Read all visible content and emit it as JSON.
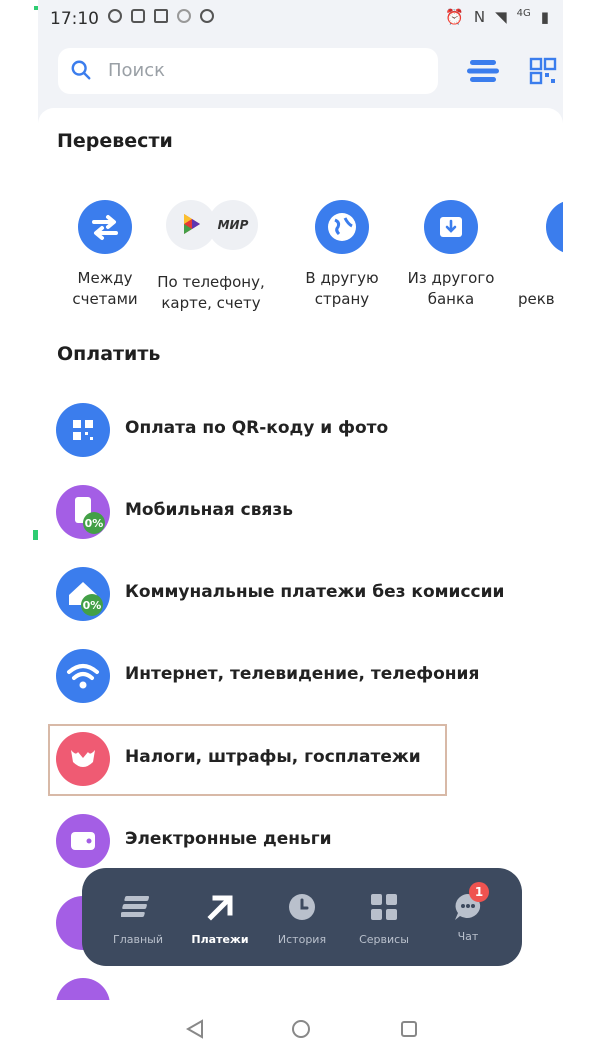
{
  "status_bar": {
    "time": "17:10",
    "network": "4G"
  },
  "search": {
    "placeholder": "Поиск"
  },
  "transfer": {
    "title": "Перевести",
    "items": [
      {
        "label_line1": "Между",
        "label_line2": "счетами",
        "icon": "arrows-exchange-icon"
      },
      {
        "label_line1": "По телефону,",
        "label_line2": "карте, счету",
        "icon": "sbp-mir-icon",
        "mir_text": "МИР"
      },
      {
        "label_line1": "В другую",
        "label_line2": "страну",
        "icon": "globe-icon"
      },
      {
        "label_line1": "Из другого",
        "label_line2": "банка",
        "icon": "download-card-icon"
      },
      {
        "label_line1": "",
        "label_line2": "рекв",
        "icon": "partial-icon"
      }
    ]
  },
  "pay": {
    "title": "Оплатить",
    "items": [
      {
        "label": "Оплата по QR-коду и фото",
        "color": "#3b7ded",
        "icon": "qr-icon"
      },
      {
        "label": "Мобильная связь",
        "color": "#a45ee5",
        "icon": "phone-zero-percent-icon",
        "badge": "0%"
      },
      {
        "label": "Коммунальные платежи без комиссии",
        "color": "#3b7ded",
        "icon": "house-zero-percent-icon",
        "badge": "0%"
      },
      {
        "label": "Интернет, телевидение, телефония",
        "color": "#3b7ded",
        "icon": "wifi-icon"
      },
      {
        "label": "Налоги, штрафы, госплатежи",
        "color": "#ef5b73",
        "icon": "emblem-icon"
      },
      {
        "label": "Электронные деньги",
        "color": "#a45ee5",
        "icon": "wallet-icon"
      }
    ]
  },
  "bottom_nav": {
    "items": [
      {
        "label": "Главный",
        "icon": "stack-icon"
      },
      {
        "label": "Платежи",
        "icon": "arrow-up-right-icon",
        "active": true
      },
      {
        "label": "История",
        "icon": "clock-icon"
      },
      {
        "label": "Сервисы",
        "icon": "grid-icon"
      },
      {
        "label": "Чат",
        "icon": "chat-icon",
        "badge": "1"
      }
    ]
  }
}
